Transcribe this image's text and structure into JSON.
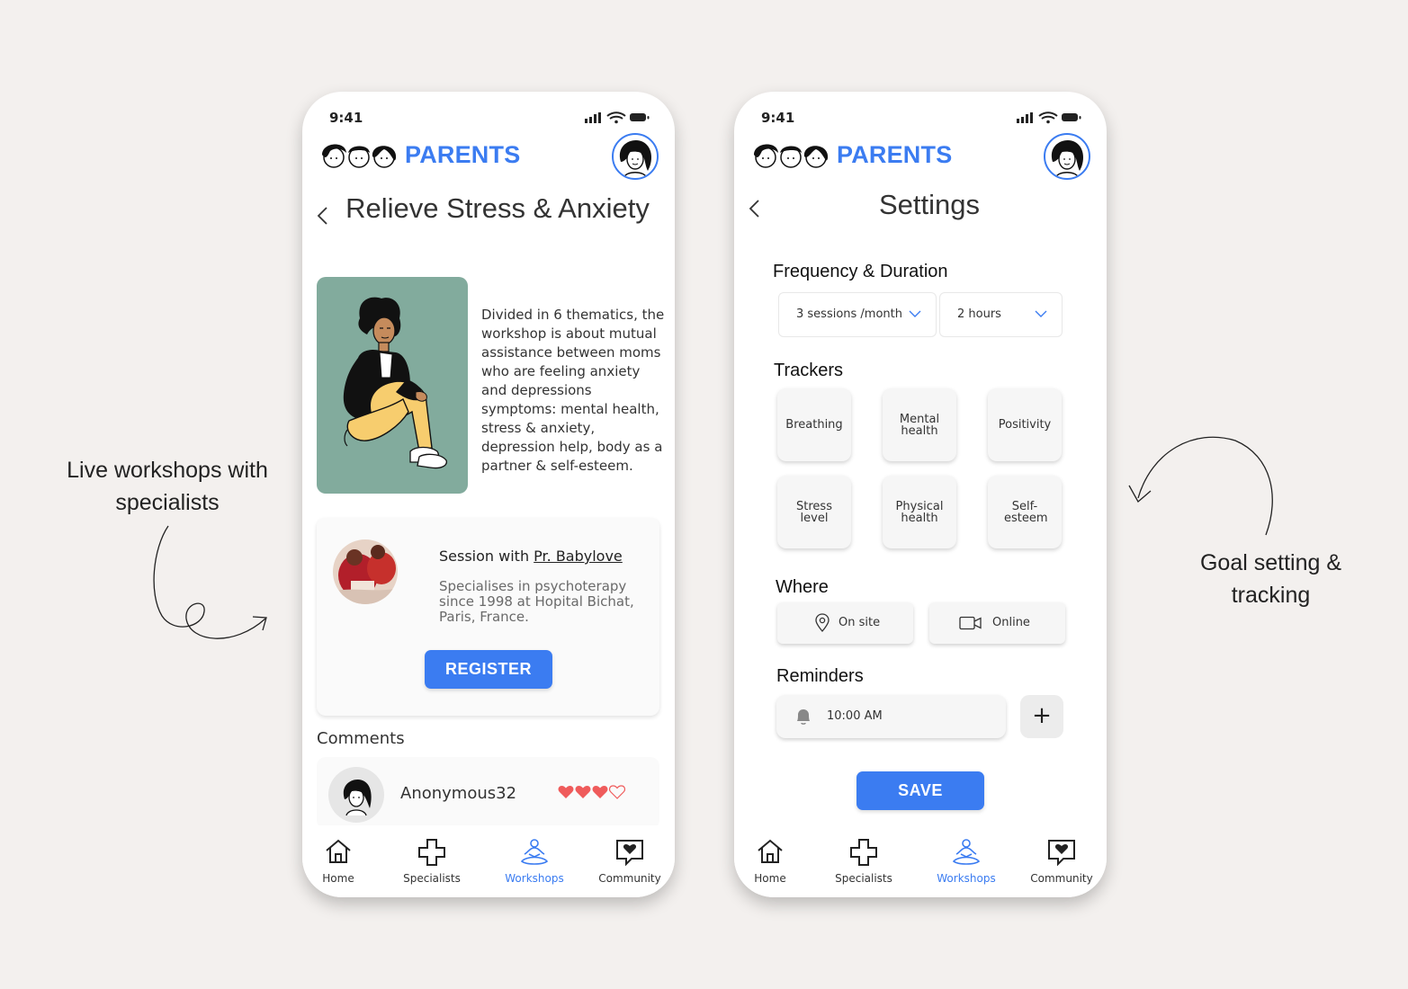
{
  "colors": {
    "background": "#f3f0ee",
    "accent": "#3b7cf1",
    "illustration_bg": "#82ab9d",
    "heart": "#ef5b5b"
  },
  "captions": {
    "left": "Live workshops with specialists",
    "right": "Goal setting & tracking"
  },
  "status_bar": {
    "time": "9:41"
  },
  "brand": {
    "name": "PARENTS"
  },
  "nav": {
    "tabs": [
      {
        "label": "Home",
        "icon": "home-icon",
        "active": false
      },
      {
        "label": "Specialists",
        "icon": "medical-cross-icon",
        "active": false
      },
      {
        "label": "Workshops",
        "icon": "meditation-icon",
        "active": true
      },
      {
        "label": "Community",
        "icon": "chat-heart-icon",
        "active": false
      }
    ]
  },
  "workshop": {
    "title": "Relieve Stress & Anxiety",
    "description": "Divided in 6 thematics, the workshop is about mutual assistance between moms who are feeling anxiety and depressions symptoms: mental health, stress & anxiety, depression help, body as a partner & self-esteem.",
    "session": {
      "prefix": "Session with ",
      "specialist": "Pr. Babylove",
      "subtitle": "Specialises in psychoterapy since 1998 at Hopital Bichat, Paris, France."
    },
    "register_label": "REGISTER",
    "comments_label": "Comments",
    "comments": [
      {
        "author": "Anonymous32",
        "rating": 3,
        "max_rating": 4
      }
    ]
  },
  "settings": {
    "title": "Settings",
    "frequency_label": "Frequency & Duration",
    "frequency_value": "3 sessions /month",
    "duration_value": "2 hours",
    "trackers_label": "Trackers",
    "trackers": [
      {
        "label": "Breathing"
      },
      {
        "label": "Mental health"
      },
      {
        "label": "Positivity"
      },
      {
        "label": "Stress level"
      },
      {
        "label": "Physical health"
      },
      {
        "label": "Self-esteem"
      }
    ],
    "where_label": "Where",
    "where_options": [
      {
        "label": "On site",
        "icon": "location-pin-icon"
      },
      {
        "label": "Online",
        "icon": "video-camera-icon"
      }
    ],
    "reminders_label": "Reminders",
    "reminder_time": "10:00 AM",
    "add_symbol": "+",
    "save_label": "SAVE"
  }
}
